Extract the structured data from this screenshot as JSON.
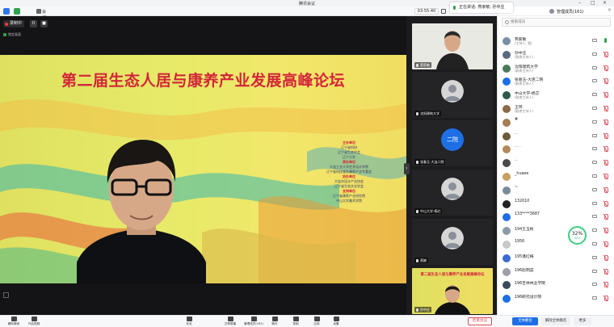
{
  "window": {
    "title": "腾讯会议"
  },
  "toolbar": {
    "meeting_code": "会议号",
    "timer": "03:55:40"
  },
  "speaker": {
    "label": "正在讲话: 燕家敏; 孙中庄"
  },
  "recording": {
    "status": "录制中",
    "pause": "II",
    "stop": "■"
  },
  "stage": {
    "hint": "锁定画面",
    "slide_title": "第二届生态人居与康养产业发展高峰论坛",
    "organizers": [
      {
        "text": "主办单位",
        "heading": true
      },
      {
        "text": "辽宁省科协"
      },
      {
        "text": "辽宁省生态学会"
      },
      {
        "text": "辽宁大学"
      },
      {
        "text": "承办单位",
        "heading": true
      },
      {
        "text": "大连工业大学艺术设计学院"
      },
      {
        "text": "辽宁省科技服务康养产业专委会"
      },
      {
        "text": "协办单位",
        "heading": true
      },
      {
        "text": "大连市设计产业协会"
      },
      {
        "text": "辽宁省生态文化学会"
      },
      {
        "text": "支持单位",
        "heading": true
      },
      {
        "text": "辽宁省康养产业研究院"
      },
      {
        "text": "中山大学美术学院"
      }
    ]
  },
  "videos": [
    {
      "name": "燕家敏",
      "type": "camera"
    },
    {
      "name": "沈阳建筑大学",
      "type": "avatar-image"
    },
    {
      "name": "张春玉-大连二院",
      "type": "avatar-text",
      "avatar_text": "二院",
      "avatar_color": "#1e6fe6"
    },
    {
      "name": "中山大学-杨芯",
      "type": "avatar-image"
    },
    {
      "name": "燕婉",
      "type": "avatar-image"
    },
    {
      "name": "孙中庄",
      "type": "slide",
      "slide_text": "第二届生态人居与康养产业发展高峰论坛"
    }
  ],
  "panel": {
    "title": "管理成员(161)",
    "close": "×",
    "search_placeholder": "搜索成员",
    "members": [
      {
        "name": "燕家敏",
        "role": "(主持人, 我)",
        "color": "#7a8fa6",
        "mic_muted": false
      },
      {
        "name": "孙中庄",
        "role": "(联席主持人)",
        "color": "#5b6b7f",
        "mic_muted": true
      },
      {
        "name": "沈阳建筑大学",
        "role": "(联席主持人)",
        "color": "#4a7a5c",
        "mic_muted": true
      },
      {
        "name": "张春玉-大连二院",
        "role": "(联席主持人)",
        "color": "#1e6fe6",
        "mic_muted": true
      },
      {
        "name": "中山大学-杨芯",
        "role": "(联席主持人)",
        "color": "#2d5a4a",
        "mic_muted": true
      },
      {
        "name": "王玮",
        "role": "(联席主持人)",
        "color": "#8a6a4a",
        "mic_muted": true
      },
      {
        "name": "#",
        "role": "",
        "color": "#a67c52",
        "mic_muted": true
      },
      {
        "name": ". .",
        "role": "",
        "color": "#6a5a3a",
        "mic_muted": true
      },
      {
        "name": ". . .",
        "role": "",
        "color": "#b08a5a",
        "mic_muted": true
      },
      {
        "name": "..",
        "role": "",
        "color": "#4a4a4a",
        "mic_muted": true
      },
      {
        "name": "_huaee",
        "role": "",
        "color": "#c8a060",
        "mic_muted": true
      },
      {
        "name": "~",
        "role": "",
        "color": "#7a8a9a",
        "mic_muted": true
      },
      {
        "name": "132010",
        "role": "",
        "color": "#222222",
        "mic_muted": true
      },
      {
        "name": "133****3687",
        "role": "",
        "color": "#1e6fe6",
        "mic_muted": true
      },
      {
        "name": "194王玉彬",
        "role": "",
        "color": "#8a9aa6",
        "mic_muted": true
      },
      {
        "name": "1956",
        "role": "",
        "color": "#c8c8c8",
        "mic_muted": true
      },
      {
        "name": "195潘红梅",
        "role": "",
        "color": "#3a6ad0",
        "mic_muted": true
      },
      {
        "name": "196赵明昊",
        "role": "",
        "color": "#9aa0a8",
        "mic_muted": true
      },
      {
        "name": "196吉林林业学院",
        "role": "",
        "color": "#3a4a5a",
        "mic_muted": true
      },
      {
        "name": "196研究设计院",
        "role": "",
        "color": "#1e6fe6",
        "mic_muted": true
      }
    ]
  },
  "network": {
    "percent": "32%",
    "label": "APU"
  },
  "bottom": {
    "items": [
      "解除静音",
      "开启视频",
      "安全",
      "共享屏幕",
      "管理成员(161)",
      "聊天",
      "录制",
      "应用",
      "设置"
    ],
    "end_meeting": "结束会议",
    "mute_all": "全体静音",
    "unmute_all": "解除全体静音",
    "more": "更多"
  }
}
